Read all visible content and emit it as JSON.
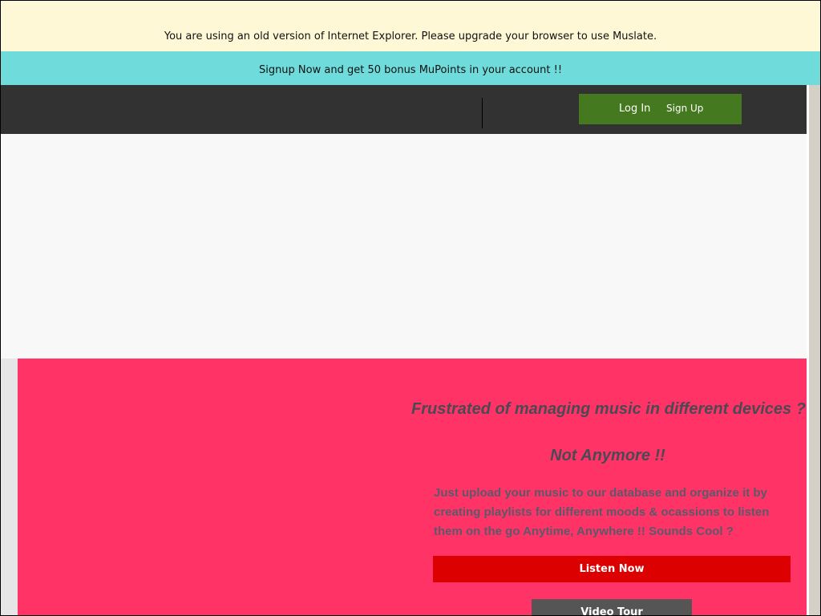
{
  "banners": {
    "ie_warning": "You are using an old version of Internet Explorer. Please upgrade your browser to use Muslate.",
    "signup_promo": "Signup Now and get 50 bonus MuPoints in your account !!"
  },
  "navbar": {
    "login_label": "Log In",
    "signup_label": "Sign Up"
  },
  "hero": {
    "title": "Frustrated of managing music in different devices ??",
    "subtitle": "Not Anymore !!",
    "body": "Just upload your music to our database and organize it by creating playlists for different moods & ocassions to listen them on the go Anytime, Anywhere !! Sounds Cool ?",
    "listen_button": "Listen Now",
    "tour_button": "Video Tour"
  },
  "colors": {
    "ie_banner_bg": "#fff8d6",
    "promo_banner_bg": "#6fdcdb",
    "navbar_bg": "#323232",
    "auth_box_bg": "#44791f",
    "hero_bg": "#ff3366",
    "listen_button_bg": "#dd0000",
    "tour_button_bg": "#555555"
  }
}
